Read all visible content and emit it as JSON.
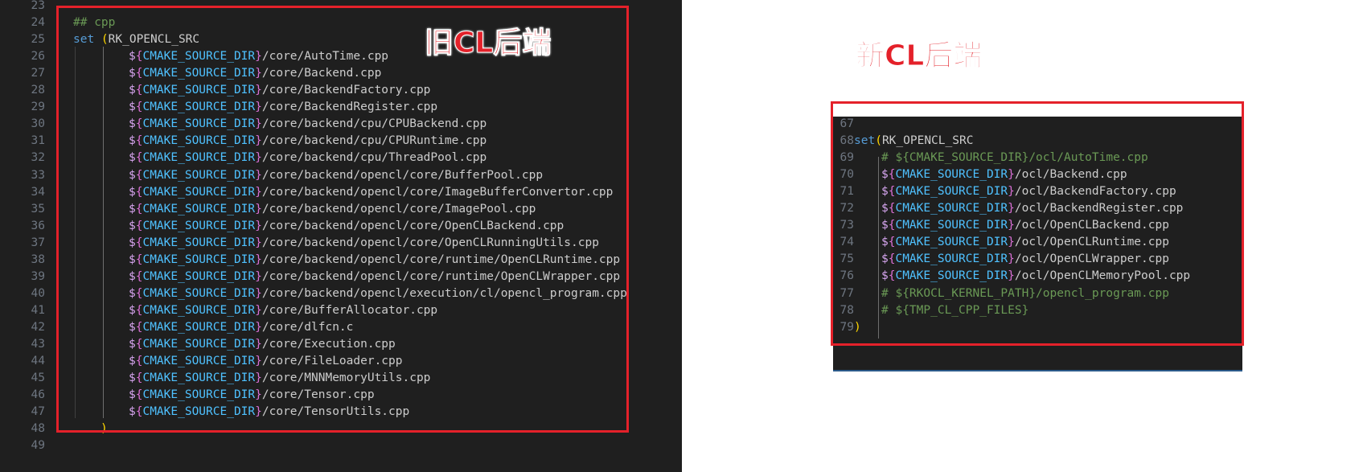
{
  "left_editor": {
    "lines": [
      {
        "num": "23",
        "parts": []
      },
      {
        "num": "24",
        "parts": [
          {
            "t": "## cpp",
            "c": "cmt"
          }
        ]
      },
      {
        "num": "25",
        "parts": [
          {
            "t": "set ",
            "c": "kw"
          },
          {
            "t": "(",
            "c": "paren"
          },
          {
            "t": "RK_OPENCL_SRC",
            "c": ""
          }
        ]
      },
      {
        "num": "26",
        "path": "/core/AutoTime.cpp"
      },
      {
        "num": "27",
        "path": "/core/Backend.cpp"
      },
      {
        "num": "28",
        "path": "/core/BackendFactory.cpp"
      },
      {
        "num": "29",
        "path": "/core/BackendRegister.cpp"
      },
      {
        "num": "30",
        "path": "/core/backend/cpu/CPUBackend.cpp"
      },
      {
        "num": "31",
        "path": "/core/backend/cpu/CPURuntime.cpp"
      },
      {
        "num": "32",
        "path": "/core/backend/cpu/ThreadPool.cpp"
      },
      {
        "num": "33",
        "path": "/core/backend/opencl/core/BufferPool.cpp"
      },
      {
        "num": "34",
        "path": "/core/backend/opencl/core/ImageBufferConvertor.cpp"
      },
      {
        "num": "35",
        "path": "/core/backend/opencl/core/ImagePool.cpp"
      },
      {
        "num": "36",
        "path": "/core/backend/opencl/core/OpenCLBackend.cpp"
      },
      {
        "num": "37",
        "path": "/core/backend/opencl/core/OpenCLRunningUtils.cpp"
      },
      {
        "num": "38",
        "path": "/core/backend/opencl/core/runtime/OpenCLRuntime.cpp"
      },
      {
        "num": "39",
        "path": "/core/backend/opencl/core/runtime/OpenCLWrapper.cpp"
      },
      {
        "num": "40",
        "path": "/core/backend/opencl/execution/cl/opencl_program.cpp"
      },
      {
        "num": "41",
        "path": "/core/BufferAllocator.cpp"
      },
      {
        "num": "42",
        "path": "/core/dlfcn.c"
      },
      {
        "num": "43",
        "path": "/core/Execution.cpp"
      },
      {
        "num": "44",
        "path": "/core/FileLoader.cpp"
      },
      {
        "num": "45",
        "path": "/core/MNNMemoryUtils.cpp"
      },
      {
        "num": "46",
        "path": "/core/Tensor.cpp"
      },
      {
        "num": "47",
        "path": "/core/TensorUtils.cpp"
      },
      {
        "num": "48",
        "close": ")"
      },
      {
        "num": "49",
        "parts": []
      }
    ],
    "var_name": "CMAKE_SOURCE_DIR"
  },
  "right_editor": {
    "lines": [
      {
        "num": "67",
        "parts": []
      },
      {
        "num": "68",
        "parts": [
          {
            "t": "set",
            "c": "kw"
          },
          {
            "t": "(",
            "c": "paren"
          },
          {
            "t": "RK_OPENCL_SRC",
            "c": ""
          }
        ]
      },
      {
        "num": "69",
        "comment": "# ${CMAKE_SOURCE_DIR}/ocl/AutoTime.cpp"
      },
      {
        "num": "70",
        "path": "/ocl/Backend.cpp"
      },
      {
        "num": "71",
        "path": "/ocl/BackendFactory.cpp"
      },
      {
        "num": "72",
        "path": "/ocl/BackendRegister.cpp"
      },
      {
        "num": "73",
        "path": "/ocl/OpenCLBackend.cpp"
      },
      {
        "num": "74",
        "path": "/ocl/OpenCLRuntime.cpp"
      },
      {
        "num": "75",
        "path": "/ocl/OpenCLWrapper.cpp"
      },
      {
        "num": "76",
        "path": "/ocl/OpenCLMemoryPool.cpp"
      },
      {
        "num": "77",
        "comment": "# ${RKOCL_KERNEL_PATH}/opencl_program.cpp"
      },
      {
        "num": "78",
        "comment": "# ${TMP_CL_CPP_FILES}"
      },
      {
        "num": "79",
        "close": ")"
      }
    ],
    "var_name": "CMAKE_SOURCE_DIR"
  },
  "annotations": {
    "old_backend": "旧CL后端",
    "new_backend": "新CL后端"
  },
  "colors": {
    "highlight_box": "#e4212a",
    "editor_bg": "#1f1f1f"
  }
}
